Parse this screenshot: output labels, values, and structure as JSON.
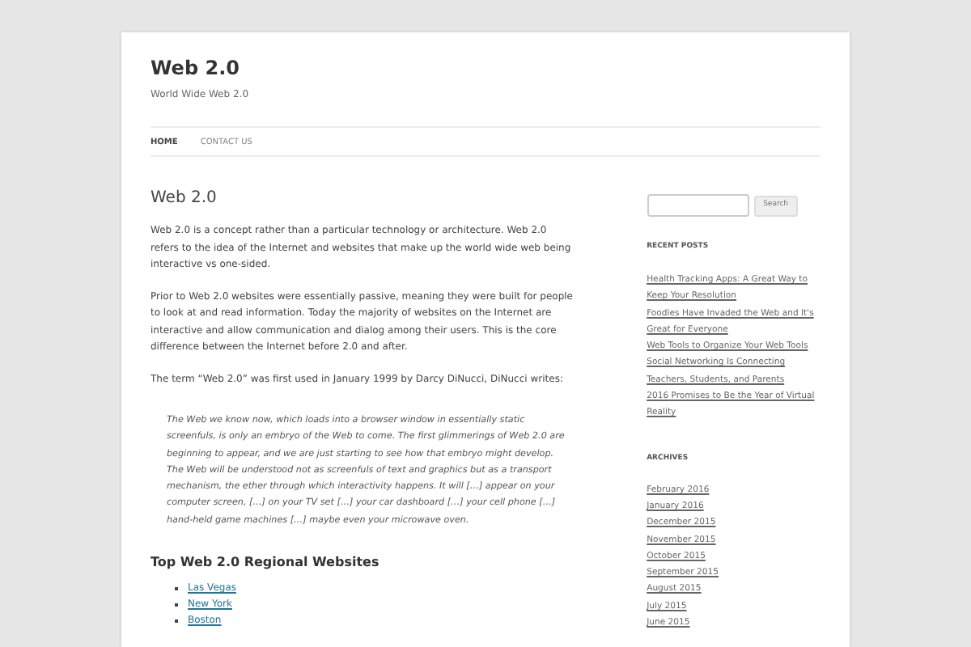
{
  "site": {
    "title": "Web 2.0",
    "tagline": "World Wide Web 2.0"
  },
  "nav": [
    {
      "label": "HOME",
      "selected": true
    },
    {
      "label": "CONTACT US",
      "selected": false
    }
  ],
  "article": {
    "title": "Web 2.0",
    "paragraphs": [
      "Web 2.0 is a concept rather than a particular technology or architecture. Web 2.0 refers to the idea of the Internet and websites that make up the world wide web being interactive vs one-sided.",
      "Prior to Web 2.0 websites were essentially passive, meaning they were built for people to look at and read information. Today the majority of websites on the Internet are interactive and allow communication and dialog among their users. This is the core difference between the Internet before 2.0 and after.",
      "The term “Web 2.0” was first used in January 1999 by Darcy DiNucci, DiNucci writes:"
    ],
    "quote": "The Web we know now, which loads into a browser window in essentially static screenfuls, is only an embryo of the Web to come. The first glimmerings of Web 2.0 are beginning to appear, and we are just starting to see how that embryo might develop. The Web will be understood not as screenfuls of text and graphics but as a transport mechanism, the ether through which interactivity happens. It will […] appear on your computer screen, […] on your TV set […] your car dashboard […] your cell phone […] hand-held game machines […] maybe even your microwave oven.",
    "subheading": "Top Web 2.0 Regional Websites",
    "links": [
      "Las Vegas",
      "New York",
      "Boston"
    ]
  },
  "sidebar": {
    "search_button": "Search",
    "recent_title": "RECENT POSTS",
    "recent_posts": [
      "Health Tracking Apps: A Great Way to Keep Your Resolution",
      "Foodies Have Invaded the Web and It's Great for Everyone",
      "Web Tools to Organize Your Web Tools",
      "Social Networking Is Connecting Teachers, Students, and Parents",
      "2016 Promises to Be the Year of Virtual Reality"
    ],
    "archives_title": "ARCHIVES",
    "archives": [
      "February 2016",
      "January 2016",
      "December 2015",
      "November 2015",
      "October 2015",
      "September 2015",
      "August 2015",
      "July 2015",
      "June 2015"
    ]
  }
}
